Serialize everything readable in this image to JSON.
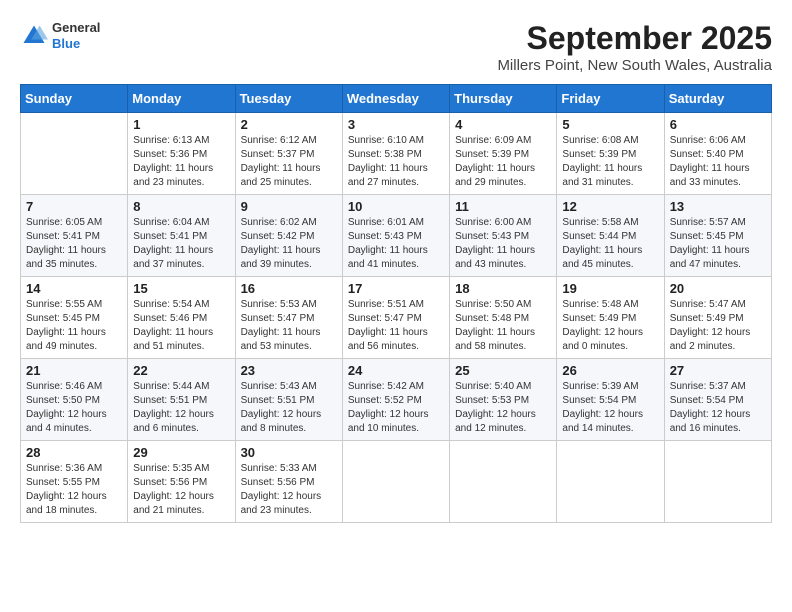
{
  "header": {
    "logo": {
      "general": "General",
      "blue": "Blue"
    },
    "title": "September 2025",
    "location": "Millers Point, New South Wales, Australia"
  },
  "weekdays": [
    "Sunday",
    "Monday",
    "Tuesday",
    "Wednesday",
    "Thursday",
    "Friday",
    "Saturday"
  ],
  "weeks": [
    [
      {
        "day": "",
        "sunrise": "",
        "sunset": "",
        "daylight": ""
      },
      {
        "day": "1",
        "sunrise": "Sunrise: 6:13 AM",
        "sunset": "Sunset: 5:36 PM",
        "daylight": "Daylight: 11 hours and 23 minutes."
      },
      {
        "day": "2",
        "sunrise": "Sunrise: 6:12 AM",
        "sunset": "Sunset: 5:37 PM",
        "daylight": "Daylight: 11 hours and 25 minutes."
      },
      {
        "day": "3",
        "sunrise": "Sunrise: 6:10 AM",
        "sunset": "Sunset: 5:38 PM",
        "daylight": "Daylight: 11 hours and 27 minutes."
      },
      {
        "day": "4",
        "sunrise": "Sunrise: 6:09 AM",
        "sunset": "Sunset: 5:39 PM",
        "daylight": "Daylight: 11 hours and 29 minutes."
      },
      {
        "day": "5",
        "sunrise": "Sunrise: 6:08 AM",
        "sunset": "Sunset: 5:39 PM",
        "daylight": "Daylight: 11 hours and 31 minutes."
      },
      {
        "day": "6",
        "sunrise": "Sunrise: 6:06 AM",
        "sunset": "Sunset: 5:40 PM",
        "daylight": "Daylight: 11 hours and 33 minutes."
      }
    ],
    [
      {
        "day": "7",
        "sunrise": "Sunrise: 6:05 AM",
        "sunset": "Sunset: 5:41 PM",
        "daylight": "Daylight: 11 hours and 35 minutes."
      },
      {
        "day": "8",
        "sunrise": "Sunrise: 6:04 AM",
        "sunset": "Sunset: 5:41 PM",
        "daylight": "Daylight: 11 hours and 37 minutes."
      },
      {
        "day": "9",
        "sunrise": "Sunrise: 6:02 AM",
        "sunset": "Sunset: 5:42 PM",
        "daylight": "Daylight: 11 hours and 39 minutes."
      },
      {
        "day": "10",
        "sunrise": "Sunrise: 6:01 AM",
        "sunset": "Sunset: 5:43 PM",
        "daylight": "Daylight: 11 hours and 41 minutes."
      },
      {
        "day": "11",
        "sunrise": "Sunrise: 6:00 AM",
        "sunset": "Sunset: 5:43 PM",
        "daylight": "Daylight: 11 hours and 43 minutes."
      },
      {
        "day": "12",
        "sunrise": "Sunrise: 5:58 AM",
        "sunset": "Sunset: 5:44 PM",
        "daylight": "Daylight: 11 hours and 45 minutes."
      },
      {
        "day": "13",
        "sunrise": "Sunrise: 5:57 AM",
        "sunset": "Sunset: 5:45 PM",
        "daylight": "Daylight: 11 hours and 47 minutes."
      }
    ],
    [
      {
        "day": "14",
        "sunrise": "Sunrise: 5:55 AM",
        "sunset": "Sunset: 5:45 PM",
        "daylight": "Daylight: 11 hours and 49 minutes."
      },
      {
        "day": "15",
        "sunrise": "Sunrise: 5:54 AM",
        "sunset": "Sunset: 5:46 PM",
        "daylight": "Daylight: 11 hours and 51 minutes."
      },
      {
        "day": "16",
        "sunrise": "Sunrise: 5:53 AM",
        "sunset": "Sunset: 5:47 PM",
        "daylight": "Daylight: 11 hours and 53 minutes."
      },
      {
        "day": "17",
        "sunrise": "Sunrise: 5:51 AM",
        "sunset": "Sunset: 5:47 PM",
        "daylight": "Daylight: 11 hours and 56 minutes."
      },
      {
        "day": "18",
        "sunrise": "Sunrise: 5:50 AM",
        "sunset": "Sunset: 5:48 PM",
        "daylight": "Daylight: 11 hours and 58 minutes."
      },
      {
        "day": "19",
        "sunrise": "Sunrise: 5:48 AM",
        "sunset": "Sunset: 5:49 PM",
        "daylight": "Daylight: 12 hours and 0 minutes."
      },
      {
        "day": "20",
        "sunrise": "Sunrise: 5:47 AM",
        "sunset": "Sunset: 5:49 PM",
        "daylight": "Daylight: 12 hours and 2 minutes."
      }
    ],
    [
      {
        "day": "21",
        "sunrise": "Sunrise: 5:46 AM",
        "sunset": "Sunset: 5:50 PM",
        "daylight": "Daylight: 12 hours and 4 minutes."
      },
      {
        "day": "22",
        "sunrise": "Sunrise: 5:44 AM",
        "sunset": "Sunset: 5:51 PM",
        "daylight": "Daylight: 12 hours and 6 minutes."
      },
      {
        "day": "23",
        "sunrise": "Sunrise: 5:43 AM",
        "sunset": "Sunset: 5:51 PM",
        "daylight": "Daylight: 12 hours and 8 minutes."
      },
      {
        "day": "24",
        "sunrise": "Sunrise: 5:42 AM",
        "sunset": "Sunset: 5:52 PM",
        "daylight": "Daylight: 12 hours and 10 minutes."
      },
      {
        "day": "25",
        "sunrise": "Sunrise: 5:40 AM",
        "sunset": "Sunset: 5:53 PM",
        "daylight": "Daylight: 12 hours and 12 minutes."
      },
      {
        "day": "26",
        "sunrise": "Sunrise: 5:39 AM",
        "sunset": "Sunset: 5:54 PM",
        "daylight": "Daylight: 12 hours and 14 minutes."
      },
      {
        "day": "27",
        "sunrise": "Sunrise: 5:37 AM",
        "sunset": "Sunset: 5:54 PM",
        "daylight": "Daylight: 12 hours and 16 minutes."
      }
    ],
    [
      {
        "day": "28",
        "sunrise": "Sunrise: 5:36 AM",
        "sunset": "Sunset: 5:55 PM",
        "daylight": "Daylight: 12 hours and 18 minutes."
      },
      {
        "day": "29",
        "sunrise": "Sunrise: 5:35 AM",
        "sunset": "Sunset: 5:56 PM",
        "daylight": "Daylight: 12 hours and 21 minutes."
      },
      {
        "day": "30",
        "sunrise": "Sunrise: 5:33 AM",
        "sunset": "Sunset: 5:56 PM",
        "daylight": "Daylight: 12 hours and 23 minutes."
      },
      {
        "day": "",
        "sunrise": "",
        "sunset": "",
        "daylight": ""
      },
      {
        "day": "",
        "sunrise": "",
        "sunset": "",
        "daylight": ""
      },
      {
        "day": "",
        "sunrise": "",
        "sunset": "",
        "daylight": ""
      },
      {
        "day": "",
        "sunrise": "",
        "sunset": "",
        "daylight": ""
      }
    ]
  ]
}
